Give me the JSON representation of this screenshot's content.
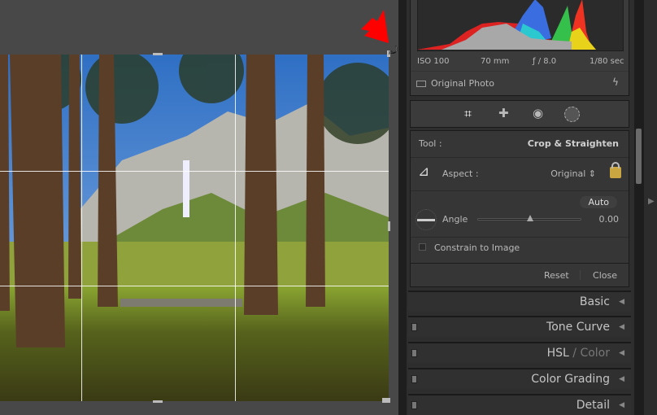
{
  "exif": {
    "iso": "ISO 100",
    "focal": "70 mm",
    "aperture": "ƒ / 8.0",
    "shutter": "1/80 sec"
  },
  "original_photo": "Original Photo",
  "tools": [
    "crop-icon",
    "healing-icon",
    "red-eye-icon",
    "mask-icon"
  ],
  "crop": {
    "tool_label": "Tool :",
    "tool_value": "Crop & Straighten",
    "aspect_label": "Aspect :",
    "aspect_value": "Original",
    "auto": "Auto",
    "angle_label": "Angle",
    "angle_value": "0.00",
    "angle_slider_fraction": 0.5,
    "constrain": "Constrain to Image",
    "constrain_checked": false,
    "reset": "Reset",
    "close": "Close"
  },
  "sections": [
    {
      "label": "Basic"
    },
    {
      "label": "Tone Curve"
    },
    {
      "label": "HSL",
      "label2": " / Color"
    },
    {
      "label": "Color Grading"
    },
    {
      "label": "Detail"
    }
  ],
  "colors": {
    "arrow": "#ff0000",
    "lock": "#c9a640"
  }
}
